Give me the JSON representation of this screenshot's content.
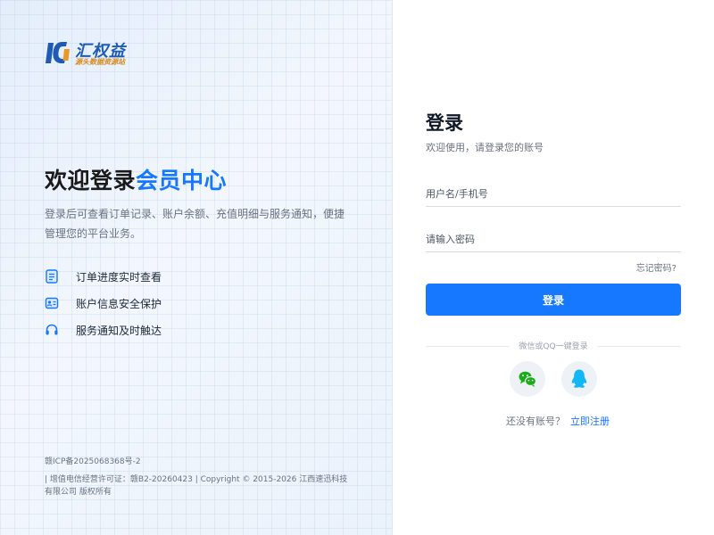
{
  "brand": {
    "name": "汇权益",
    "tagline": "源头数据资源站",
    "primary_color": "#1d5bb5",
    "accent_color": "#d88a1e"
  },
  "hero": {
    "title_main": "欢迎登录",
    "title_highlight": "会员中心",
    "description": "登录后可查看订单记录、账户余额、充值明细与服务通知，便捷管理您的平台业务。",
    "highlight_color": "#1677ff"
  },
  "features": [
    {
      "icon": "order-list-icon",
      "label": "订单进度实时查看"
    },
    {
      "icon": "account-shield-icon",
      "label": "账户信息安全保护"
    },
    {
      "icon": "headset-icon",
      "label": "服务通知及时触达"
    }
  ],
  "footer": {
    "icp": "赣ICP备2025068368号-2",
    "license": "| 增值电信经营许可证：赣B2-20260423 | Copyright © 2015-2026 江西速迅科技有限公司 版权所有"
  },
  "login": {
    "title": "登录",
    "subtitle": "欢迎使用，请登录您的账号",
    "username": {
      "placeholder": "用户名/手机号",
      "value": ""
    },
    "password": {
      "placeholder": "请输入密码",
      "value": ""
    },
    "forgot": "忘记密码?",
    "submit": "登录",
    "button_color": "#1677ff",
    "social_label": "微信或QQ一键登录",
    "social": [
      {
        "icon": "wechat-icon",
        "color": "#1aad19"
      },
      {
        "icon": "qq-icon",
        "color": "#12b7f5"
      }
    ],
    "signup_prompt": "还没有账号？",
    "signup_link": "立即注册"
  }
}
